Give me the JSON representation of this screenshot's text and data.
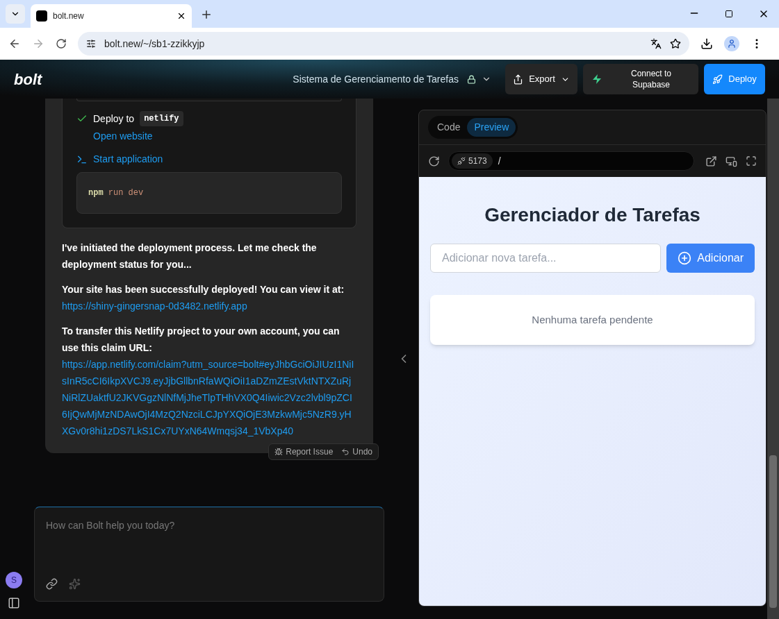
{
  "browser": {
    "tab_title": "bolt.new",
    "address": "bolt.new/~/sb1-zzikkyjp"
  },
  "header": {
    "logo": "bolt",
    "project_title": "Sistema de Gerenciamento de Tarefas",
    "export_label": "Export",
    "supabase_label": "Connect to Supabase",
    "deploy_label": "Deploy"
  },
  "chat": {
    "action": {
      "done": true,
      "label": "Deploy to",
      "target": "netlify",
      "link": "Open website"
    },
    "start": {
      "label": "Start application",
      "program": "npm",
      "args": "run dev"
    },
    "paragraphs": [
      {
        "text": "I've initiated the deployment process. Let me check the deployment status for you..."
      },
      {
        "text": "Your site has been successfully deployed! You can view it at:",
        "link": "https://shiny-gingersnap-0d3482.netlify.app"
      },
      {
        "text": "To transfer this Netlify project to your own account, you can use  this claim URL:",
        "link": "https://app.netlify.com/claim?utm_source=bolt#eyJhbGciOiJIUzI1NiIsInR5cCI6IkpXVCJ9.eyJjbGllbnRfaWQiOiI1aDZmZEstVktNTXZuRjNiRlZUaktfU2JKVGgzNlNfMjJheTlpTHhVX0Q4Iiwic2Vzc2lvbl9pZCI6IjQwMjMzNDAwOjI4MzQ2NzciLCJpYXQiOjE3MzkwMjc5NzR9.yHXGv0r8hi1zDS7LkS1Cx7UYxN64Wmqsj34_1VbXp40"
      }
    ],
    "feedback": {
      "report": "Report Issue",
      "undo": "Undo"
    },
    "input": {
      "placeholder": "How can Bolt help you today?"
    },
    "avatar": "S"
  },
  "preview": {
    "tabs": [
      {
        "label": "Code",
        "selected": false
      },
      {
        "label": "Preview",
        "selected": true
      }
    ],
    "port": "5173",
    "path": "/",
    "app": {
      "title": "Gerenciador de Tarefas",
      "input_placeholder": "Adicionar nova tarefa...",
      "add_label": "Adicionar",
      "empty": "Nenhuma tarefa pendente"
    }
  }
}
